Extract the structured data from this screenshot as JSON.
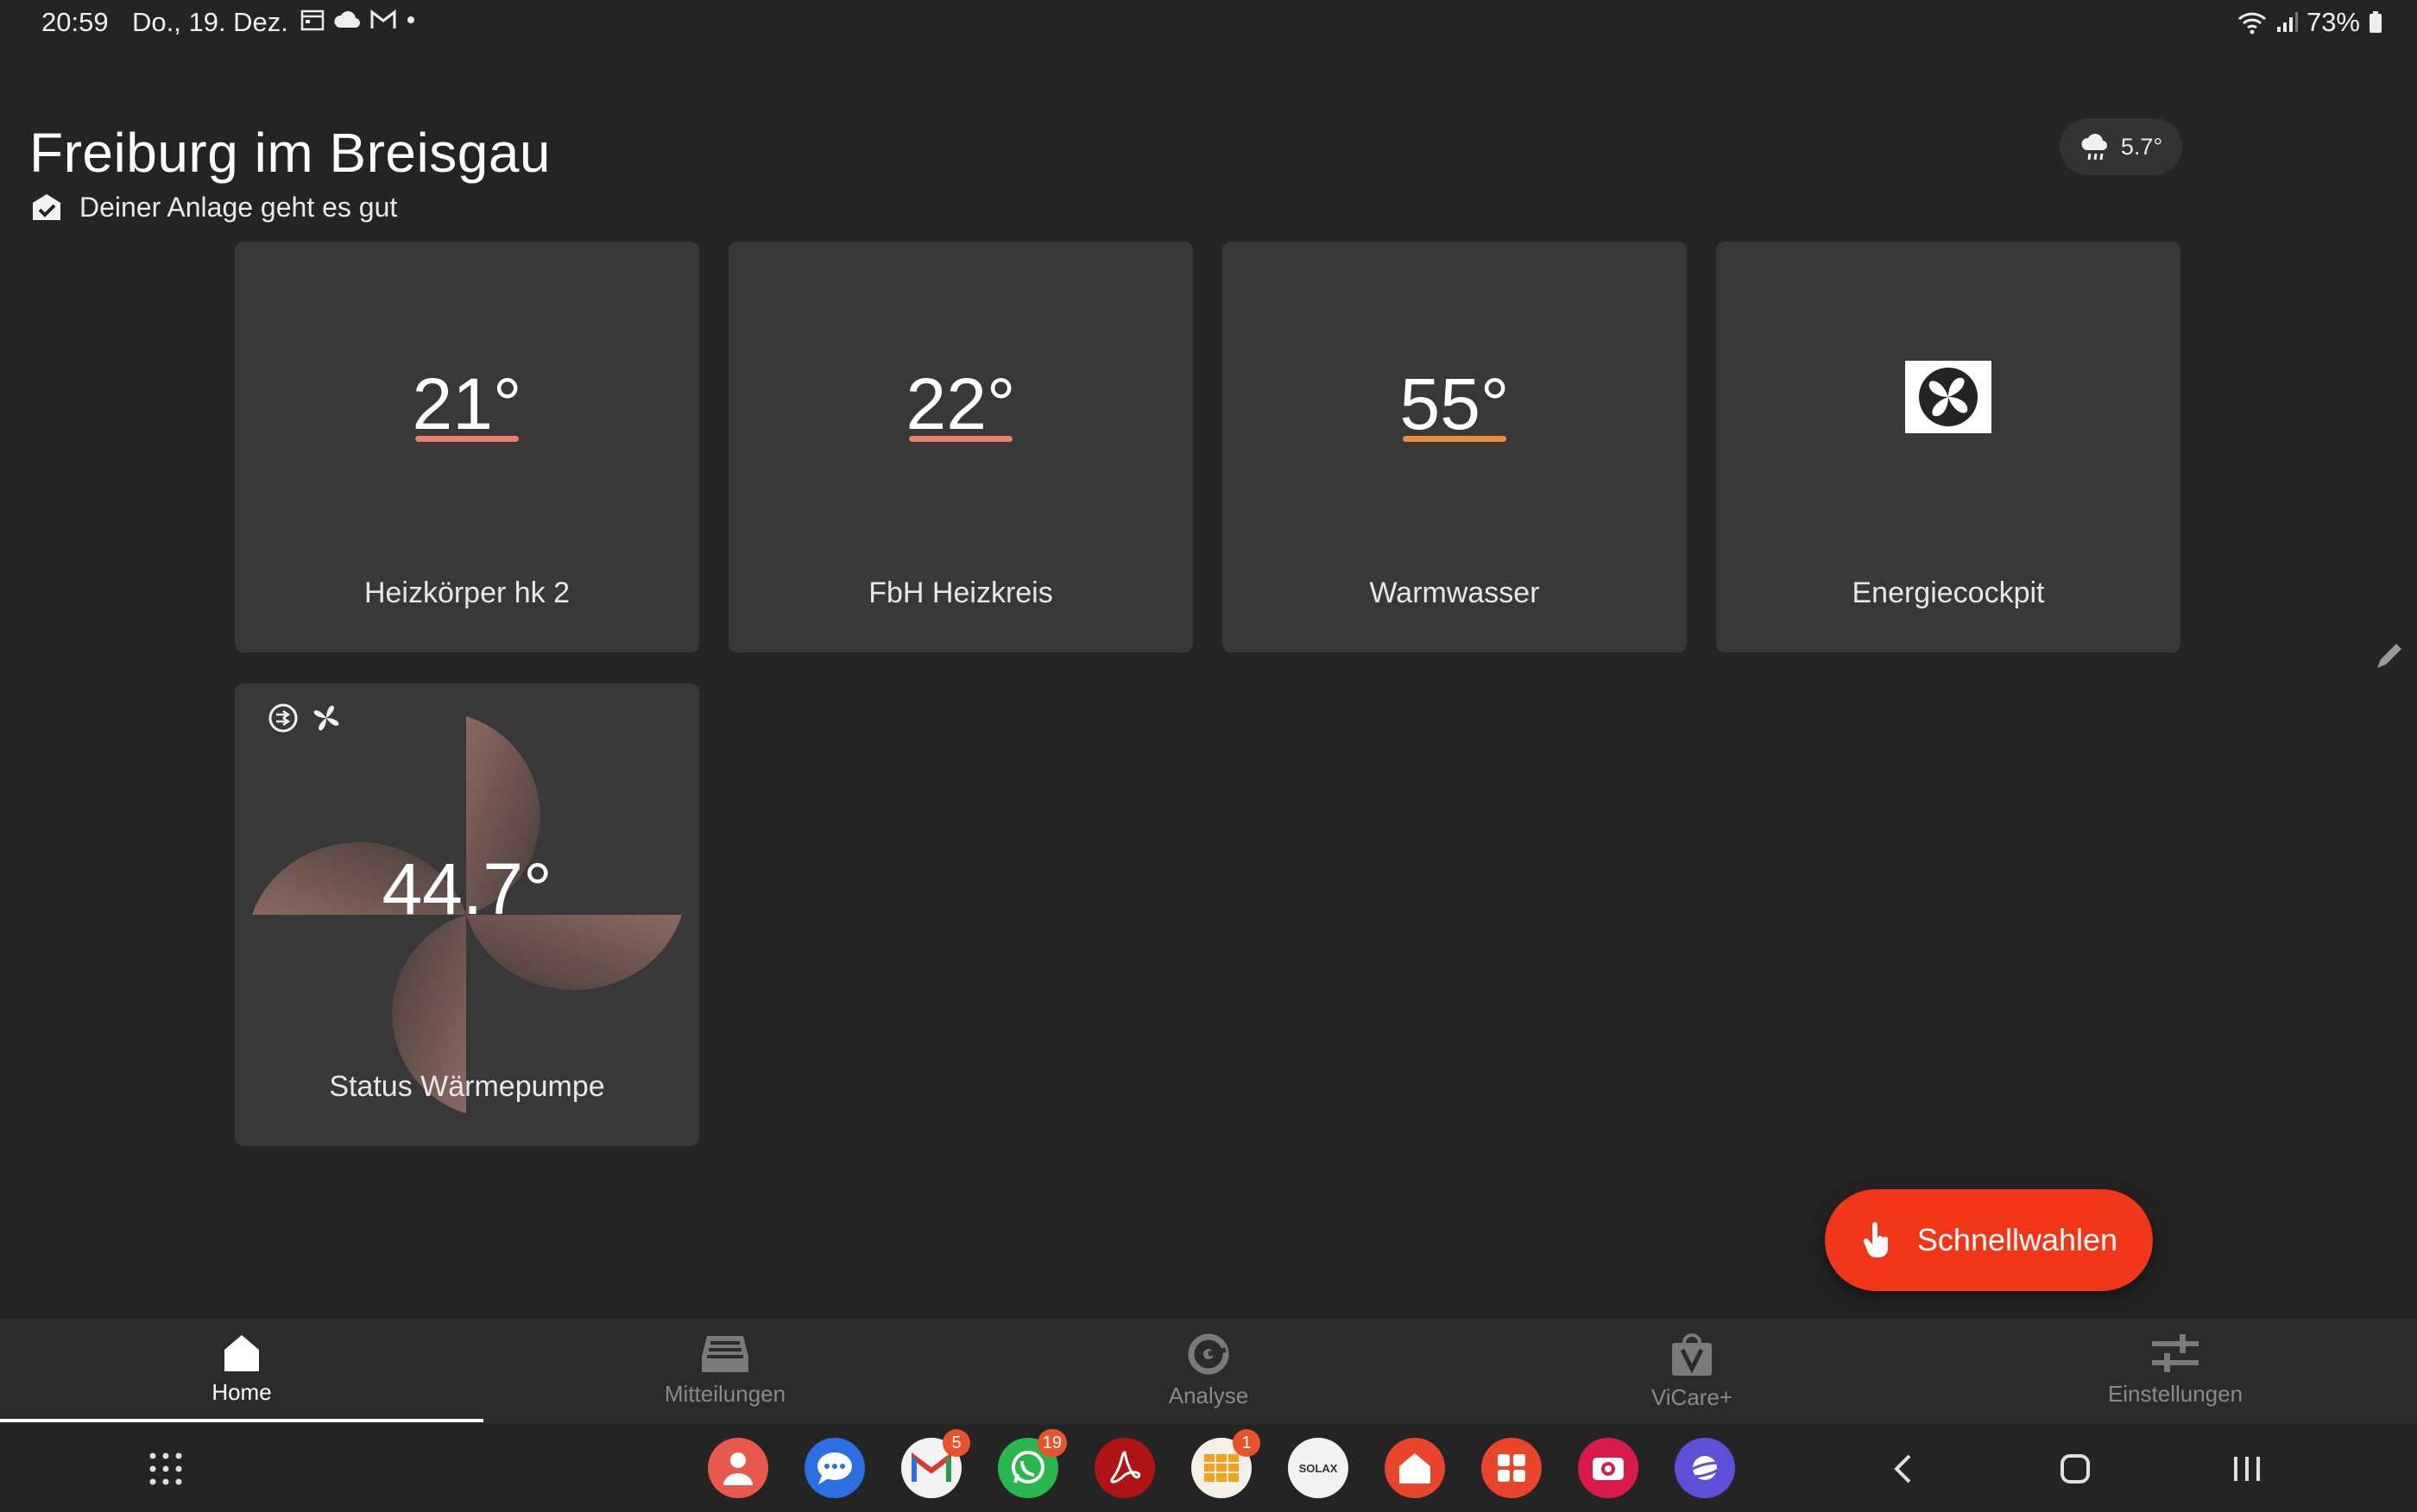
{
  "status_bar": {
    "time": "20:59",
    "date": "Do., 19. Dez.",
    "battery": "73%"
  },
  "header": {
    "title": "Freiburg im Breisgau",
    "status_text": "Deiner Anlage geht es gut",
    "weather_temp": "5.7°"
  },
  "tiles": [
    {
      "value": "21°",
      "label": "Heizkörper hk  2",
      "bar_color": "#f07c6a"
    },
    {
      "value": "22°",
      "label": "FbH Heizkreis",
      "bar_color": "#f07c6a"
    },
    {
      "value": "55°",
      "label": "Warmwasser",
      "bar_color": "#f2893a"
    },
    {
      "label": "Energiecockpit",
      "icon": "fan-icon"
    }
  ],
  "heatpump": {
    "value": "44.7°",
    "label": "Status Wärmepumpe"
  },
  "fab": {
    "label": "Schnellwahlen"
  },
  "nav": [
    {
      "label": "Home",
      "icon": "home-icon",
      "active": true
    },
    {
      "label": "Mitteilungen",
      "icon": "inbox-icon"
    },
    {
      "label": "Analyse",
      "icon": "analysis-icon"
    },
    {
      "label": "ViCare+",
      "icon": "shopping-bag-icon"
    },
    {
      "label": "Einstellungen",
      "icon": "sliders-icon"
    }
  ],
  "dock": {
    "gmail_badge": "5",
    "whatsapp_badge": "19",
    "app6_badge": "1",
    "solax_label": "SOLAX"
  },
  "colors": {
    "accent": "#f2361a",
    "background": "#242424",
    "tile": "#383838"
  }
}
